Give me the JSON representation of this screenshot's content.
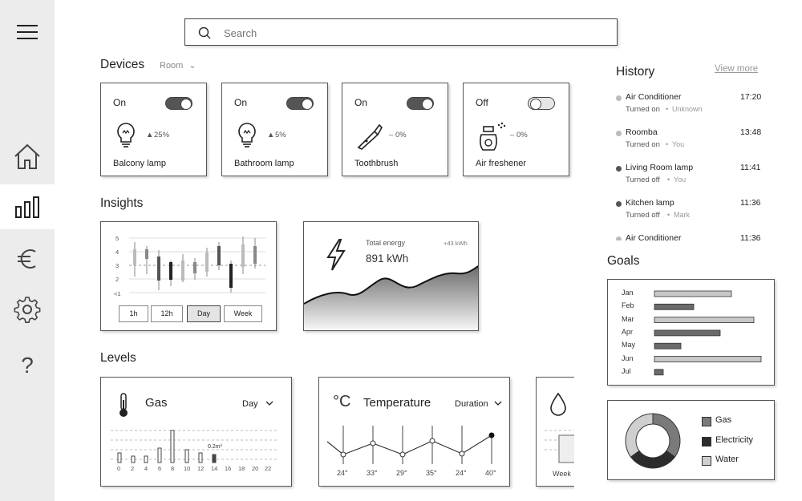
{
  "search": {
    "placeholder": "Search"
  },
  "devices": {
    "title": "Devices",
    "room_filter": "Room",
    "items": [
      {
        "state": "On",
        "on": true,
        "name": "Balcony lamp",
        "change": "25%",
        "dir": "up"
      },
      {
        "state": "On",
        "on": true,
        "name": "Bathroom lamp",
        "change": "5%",
        "dir": "up"
      },
      {
        "state": "On",
        "on": true,
        "name": "Toothbrush",
        "change": "0%",
        "dir": "flat"
      },
      {
        "state": "Off",
        "on": false,
        "name": "Air freshener",
        "change": "0%",
        "dir": "flat"
      }
    ]
  },
  "insights": {
    "title": "Insights",
    "y_ticks": [
      "5",
      "4",
      "3",
      "2",
      "<1"
    ],
    "ranges": [
      "1h",
      "12h",
      "Day",
      "Week"
    ],
    "selected_range": "Day",
    "energy": {
      "label": "Total energy",
      "value": "891 kWh",
      "delta": "+43 kWh"
    }
  },
  "levels": {
    "title": "Levels",
    "gas": {
      "title": "Gas",
      "period": "Day",
      "annotation": "0.2m³",
      "x_ticks": [
        "0",
        "2",
        "4",
        "6",
        "8",
        "10",
        "12",
        "14",
        "16",
        "18",
        "20",
        "22"
      ]
    },
    "temperature": {
      "title": "Temperature",
      "unit_symbol": "°C",
      "period": "Duration",
      "values": [
        "24°",
        "33°",
        "29°",
        "35°",
        "24°",
        "40°"
      ]
    },
    "third": {
      "period": "Week"
    }
  },
  "history": {
    "title": "History",
    "view_more": "View more",
    "items": [
      {
        "device": "Air Conditioner",
        "action": "Turned on",
        "by": "Unknown",
        "time": "17:20",
        "color": "#bbbbbb"
      },
      {
        "device": "Roomba",
        "action": "Turned on",
        "by": "You",
        "time": "13:48",
        "color": "#bbbbbb"
      },
      {
        "device": "Living Room lamp",
        "action": "Turned off",
        "by": "You",
        "time": "11:41",
        "color": "#555555"
      },
      {
        "device": "Kitchen lamp",
        "action": "Turned off",
        "by": "Mark",
        "time": "11:36",
        "color": "#555555"
      },
      {
        "device": "Air Conditioner",
        "action": "",
        "by": "",
        "time": "11:36",
        "color": "#bbbbbb"
      }
    ]
  },
  "goals": {
    "title": "Goals",
    "chart_data": {
      "type": "bar",
      "orientation": "horizontal",
      "categories": [
        "Jan",
        "Feb",
        "Mar",
        "Apr",
        "May",
        "Jun",
        "Jul"
      ],
      "values": [
        0.72,
        0.37,
        0.93,
        0.62,
        0.25,
        1.0,
        0.08
      ],
      "colors": [
        "#c8c8c8",
        "#6a6a6a",
        "#c8c8c8",
        "#6a6a6a",
        "#6a6a6a",
        "#c8c8c8",
        "#6a6a6a"
      ]
    }
  },
  "usage": {
    "chart_data": {
      "type": "pie",
      "labels": [
        "Gas",
        "Electricity",
        "Water"
      ],
      "values": [
        35,
        30,
        35
      ],
      "colors": [
        "#7a7a7a",
        "#2c2c2c",
        "#cfcfcf"
      ]
    }
  }
}
